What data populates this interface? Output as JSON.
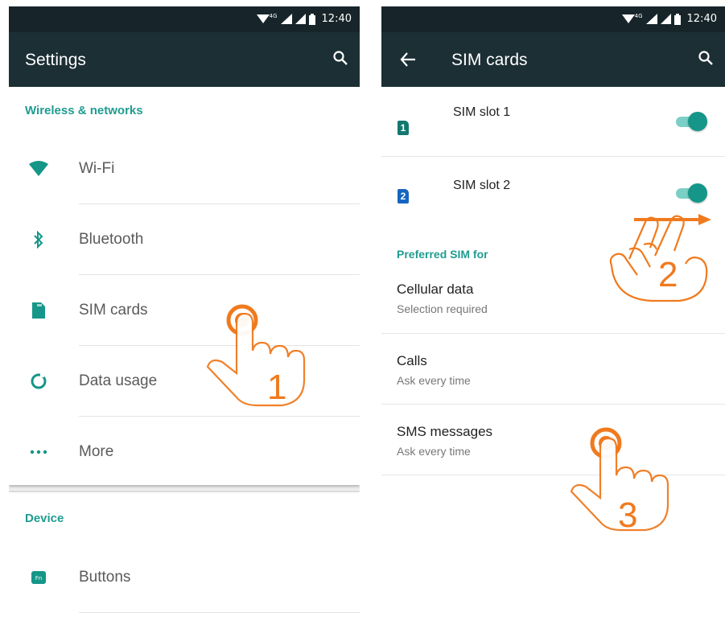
{
  "status_bar": {
    "network": "4G",
    "time": "12:40"
  },
  "settings": {
    "title": "Settings",
    "wireless_header": "Wireless & networks",
    "items": [
      {
        "label": "Wi-Fi",
        "icon": "wifi-icon"
      },
      {
        "label": "Bluetooth",
        "icon": "bluetooth-icon"
      },
      {
        "label": "SIM cards",
        "icon": "sim-card-icon"
      },
      {
        "label": "Data usage",
        "icon": "data-usage-icon"
      },
      {
        "label": "More",
        "icon": "more-dots-icon"
      }
    ],
    "device_header": "Device",
    "device_items": [
      {
        "label": "Buttons",
        "icon": "fn-button-icon"
      }
    ]
  },
  "sim_cards": {
    "title": "SIM cards",
    "slots": [
      {
        "badge": "1",
        "label": "SIM slot 1",
        "enabled": true,
        "badge_color": "#13796f"
      },
      {
        "badge": "2",
        "label": "SIM slot 2",
        "enabled": true,
        "badge_color": "#1565c0"
      }
    ],
    "preferred_header": "Preferred SIM for",
    "preferred": [
      {
        "title": "Cellular data",
        "subtitle": "Selection required"
      },
      {
        "title": "Calls",
        "subtitle": "Ask every time"
      },
      {
        "title": "SMS messages",
        "subtitle": "Ask every time"
      }
    ]
  },
  "annotations": {
    "step1": "1",
    "step2": "2",
    "step3": "3"
  },
  "colors": {
    "appbar": "#1c2f35",
    "statusbar": "#17252a",
    "accent": "#1f9c91",
    "annotation": "#f07a1e"
  }
}
